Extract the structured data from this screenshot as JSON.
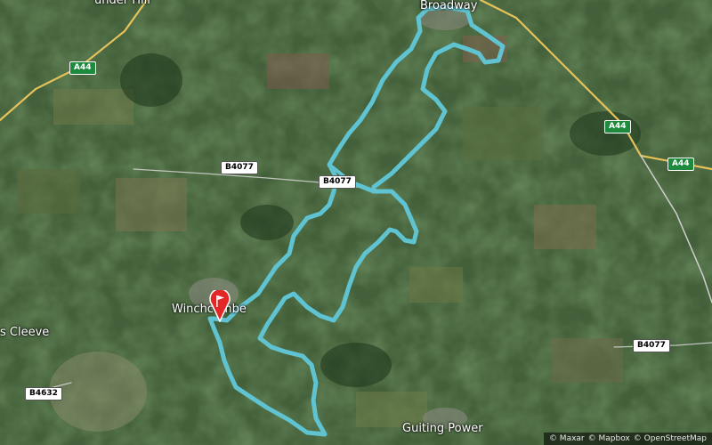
{
  "map": {
    "places": [
      {
        "name": "Broadway"
      },
      {
        "name": "Winchcombe"
      },
      {
        "name": "s Cleeve"
      },
      {
        "name": "Guiting Power"
      },
      {
        "name": "under Hill"
      }
    ],
    "roads": [
      {
        "ref": "A44"
      },
      {
        "ref": "A44"
      },
      {
        "ref": "A44"
      },
      {
        "ref": "B4077"
      },
      {
        "ref": "B4077"
      },
      {
        "ref": "B4077"
      },
      {
        "ref": "B4632"
      }
    ],
    "attribution": [
      "© Maxar",
      "© Mapbox",
      "© OpenStreetMap"
    ],
    "route_color": "#5fc3d1",
    "start_marker_icon": "flag-icon",
    "start_marker_color": "#e32626"
  }
}
